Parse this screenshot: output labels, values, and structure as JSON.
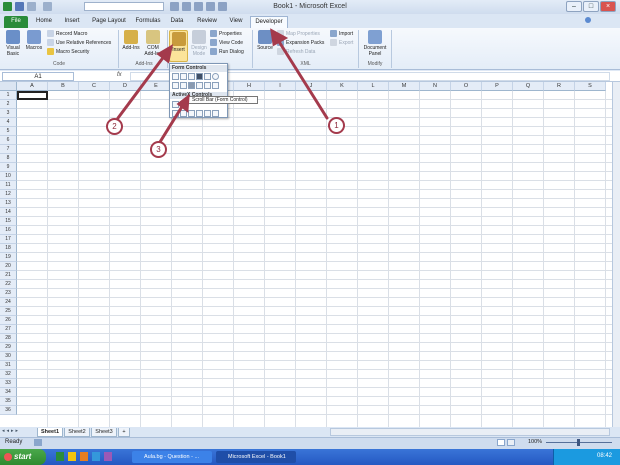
{
  "window": {
    "title": "Book1 - Microsoft Excel"
  },
  "tabs": [
    "File",
    "Home",
    "Insert",
    "Page Layout",
    "Formulas",
    "Data",
    "Review",
    "View",
    "Developer"
  ],
  "ribbon": {
    "code": {
      "label": "Code",
      "visual_basic": "Visual Basic",
      "macros": "Macros",
      "record_macro": "Record Macro",
      "use_relative": "Use Relative References",
      "macro_security": "Macro Security"
    },
    "addins": {
      "label": "Add-Ins",
      "addins": "Add-Ins",
      "com_addins": "COM Add-Ins"
    },
    "controls": {
      "insert": "Insert",
      "design_mode": "Design Mode",
      "properties": "Properties",
      "view_code": "View Code",
      "run_dialog": "Run Dialog"
    },
    "xml": {
      "label": "XML",
      "source": "Source",
      "map_properties": "Map Properties",
      "expansion_packs": "Expansion Packs",
      "refresh_data": "Refresh Data",
      "import": "Import",
      "export": "Export"
    },
    "modify": {
      "label": "Modify",
      "document_panel": "Document Panel"
    }
  },
  "formula_bar": {
    "name_box": "A1",
    "fx": "fx"
  },
  "columns": [
    "A",
    "B",
    "C",
    "D",
    "E",
    "F",
    "G",
    "H",
    "I",
    "J",
    "K",
    "L",
    "M",
    "N",
    "O",
    "P",
    "Q",
    "R",
    "S"
  ],
  "rows": [
    "1",
    "2",
    "3",
    "4",
    "5",
    "6",
    "7",
    "8",
    "9",
    "10",
    "11",
    "12",
    "13",
    "14",
    "15",
    "16",
    "17",
    "18",
    "19",
    "20",
    "21",
    "22",
    "23",
    "24",
    "25",
    "26",
    "27",
    "28",
    "29",
    "30",
    "31",
    "32",
    "33",
    "34",
    "35",
    "36"
  ],
  "popup": {
    "form_controls": "Form Controls",
    "activex_controls": "ActiveX Controls"
  },
  "tooltip": "Scroll Bar (Form Control)",
  "callouts": [
    "1",
    "2",
    "3"
  ],
  "sheets": [
    "Sheet1",
    "Sheet2",
    "Sheet3"
  ],
  "status": {
    "ready": "Ready",
    "zoom": "100%"
  },
  "taskbar": {
    "start": "start",
    "task1": "Aula.bg - Question - ...",
    "task2": "Microsoft Excel - Book1",
    "clock": "08:42"
  },
  "colors": {
    "file_tab": "#2a8c3a",
    "callout": "#a43a4c",
    "taskbar": "#2458c2"
  }
}
